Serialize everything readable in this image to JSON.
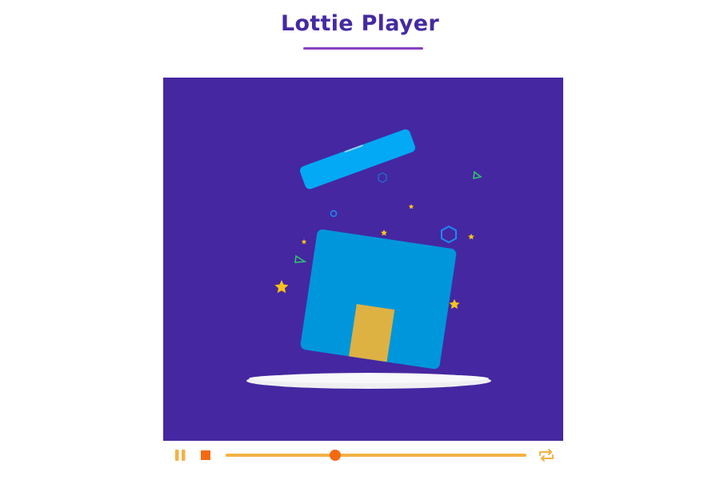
{
  "page": {
    "title": "Lottie Player"
  },
  "player": {
    "progress": 0.365,
    "state": "playing",
    "loop": true,
    "colors": {
      "background": "#4527a1",
      "box": "#0096db",
      "lid": "#03a9f4",
      "ribbon": "#deb143",
      "star": "#f8c21a",
      "controls": "#f2b244",
      "accent": "#f46a12"
    }
  },
  "controls": {
    "pause_icon": "pause-icon",
    "stop_icon": "stop-icon",
    "loop_icon": "loop-icon"
  }
}
